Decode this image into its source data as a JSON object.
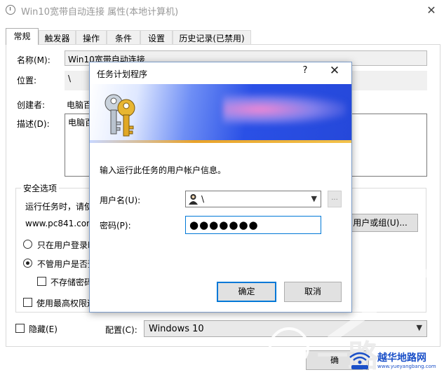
{
  "main_window": {
    "title": "Win10宽带自动连接 属性(本地计算机)",
    "close_glyph": "✕",
    "tabs": [
      "常规",
      "触发器",
      "操作",
      "条件",
      "设置",
      "历史记录(已禁用)"
    ],
    "general": {
      "name_label": "名称(M):",
      "name_value": "Win10宽带自动连接",
      "location_label": "位置:",
      "location_value": "\\",
      "author_label": "创建者:",
      "author_value": "电脑百",
      "description_label": "描述(D):",
      "description_value": "电脑百",
      "security_group_title": "安全选项",
      "run_as_text": "运行任务时，请使",
      "run_as_user": "www.pc841.com",
      "change_user_button": "用户或组(U)...",
      "radio_logged_on": "只在用户登录时",
      "radio_any": "不管用户是否登",
      "checkbox_no_store_password": "不存储密码",
      "checkbox_highest_privileges": "使用最高权限运",
      "hidden_label": "隐藏(E)",
      "configure_label": "配置(C):",
      "configure_value": "Windows 10",
      "bottom_button_partial": "确"
    }
  },
  "dialog": {
    "title": "任务计划程序",
    "help_glyph": "?",
    "close_glyph": "✕",
    "prompt": "输入运行此任务的用户帐户信息。",
    "username_label": "用户名(U):",
    "username_value": "\\",
    "browse_glyph": "...",
    "password_label": "密码(P):",
    "password_value": "●●●●●●●",
    "ok_button": "确定",
    "cancel_button": "取消"
  },
  "watermark": {
    "big_text": "一路",
    "brand": "越华地路网",
    "url": "www.yueyangbang.com"
  },
  "colors": {
    "accent": "#0078d7",
    "banner_blue": "#2548da",
    "watermark_blue": "#1b50c8"
  },
  "icons": {
    "title_icon": "clock-icon",
    "dialog_icon": "keys-icon",
    "user_icon": "user-avatar-icon"
  }
}
